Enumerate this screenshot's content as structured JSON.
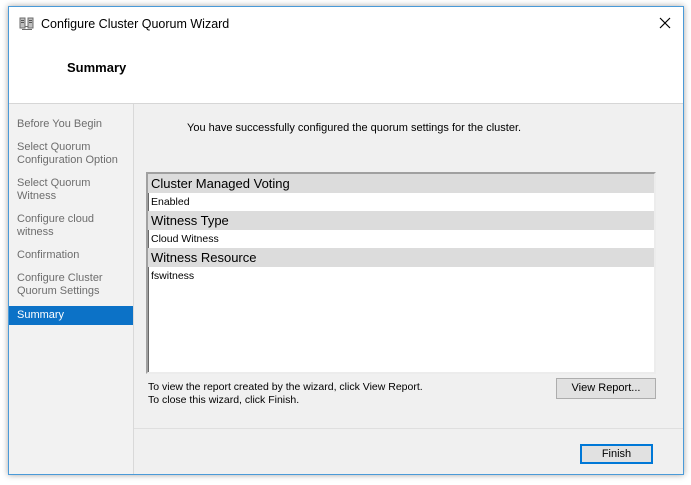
{
  "window": {
    "title": "Configure Cluster Quorum Wizard",
    "icon": "cluster-wizard-icon",
    "close_glyph": "✕"
  },
  "header": {
    "page_title": "Summary"
  },
  "sidebar": {
    "steps": [
      {
        "label": "Before You Begin",
        "active": false
      },
      {
        "label": "Select Quorum Configuration Option",
        "active": false
      },
      {
        "label": "Select Quorum Witness",
        "active": false
      },
      {
        "label": "Configure cloud witness",
        "active": false
      },
      {
        "label": "Confirmation",
        "active": false
      },
      {
        "label": "Configure Cluster Quorum Settings",
        "active": false
      },
      {
        "label": "Summary",
        "active": true
      }
    ]
  },
  "main": {
    "intro": "You have successfully configured the quorum settings for the cluster.",
    "report": {
      "sections": [
        {
          "title": "Cluster Managed Voting",
          "value": "Enabled"
        },
        {
          "title": "Witness Type",
          "value": "Cloud Witness"
        },
        {
          "title": "Witness Resource",
          "value": "fswitness"
        }
      ]
    },
    "help_line1": "To view the report created by the wizard, click View Report.",
    "help_line2": "To close this wizard, click Finish.",
    "view_report_label": "View Report...",
    "finish_label": "Finish"
  },
  "colors": {
    "accent": "#0c72c7",
    "window_border": "#4a9ad8",
    "section_header_bg": "#dcdcdc"
  }
}
